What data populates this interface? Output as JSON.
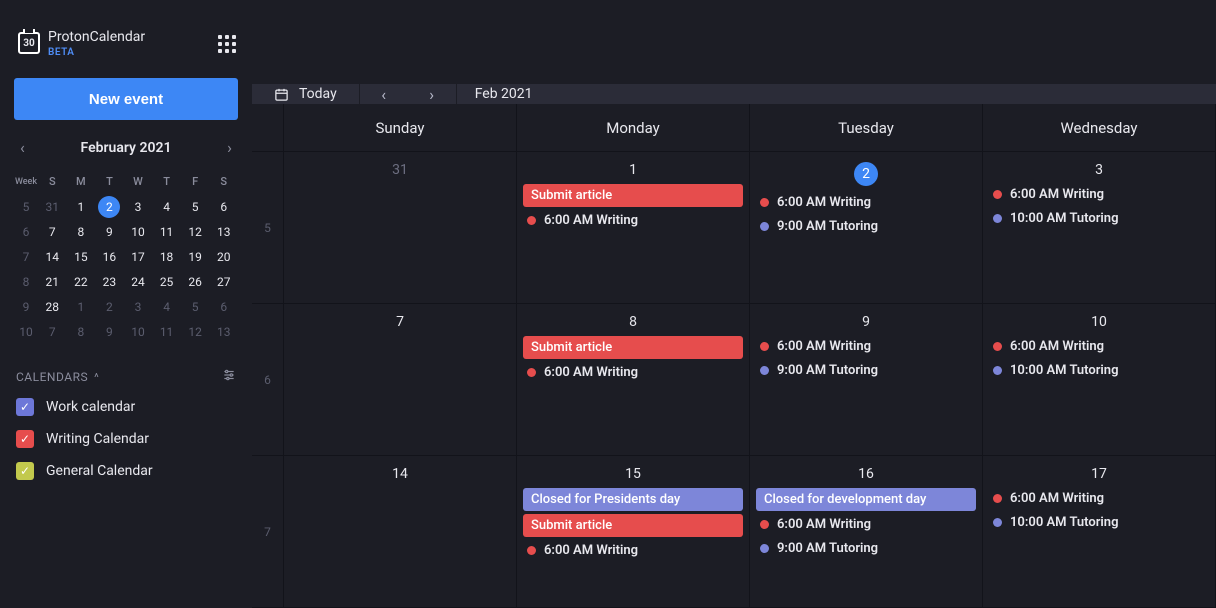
{
  "brand": {
    "name": "ProtonCalendar",
    "icon_label": "30",
    "beta": "BETA"
  },
  "sidebar": {
    "new_event": "New event",
    "mini_cal": {
      "title": "February 2021",
      "week_label": "Week",
      "weekday_heads": [
        "S",
        "M",
        "T",
        "W",
        "T",
        "F",
        "S"
      ],
      "rows": [
        {
          "wk": "5",
          "days": [
            {
              "n": "31",
              "out": true
            },
            {
              "n": "1"
            },
            {
              "n": "2",
              "today": true
            },
            {
              "n": "3"
            },
            {
              "n": "4"
            },
            {
              "n": "5"
            },
            {
              "n": "6"
            }
          ]
        },
        {
          "wk": "6",
          "days": [
            {
              "n": "7"
            },
            {
              "n": "8"
            },
            {
              "n": "9"
            },
            {
              "n": "10"
            },
            {
              "n": "11"
            },
            {
              "n": "12"
            },
            {
              "n": "13"
            }
          ]
        },
        {
          "wk": "7",
          "days": [
            {
              "n": "14"
            },
            {
              "n": "15"
            },
            {
              "n": "16"
            },
            {
              "n": "17"
            },
            {
              "n": "18"
            },
            {
              "n": "19"
            },
            {
              "n": "20"
            }
          ]
        },
        {
          "wk": "8",
          "days": [
            {
              "n": "21"
            },
            {
              "n": "22"
            },
            {
              "n": "23"
            },
            {
              "n": "24"
            },
            {
              "n": "25"
            },
            {
              "n": "26"
            },
            {
              "n": "27"
            }
          ]
        },
        {
          "wk": "9",
          "days": [
            {
              "n": "28"
            },
            {
              "n": "1",
              "out": true
            },
            {
              "n": "2",
              "out": true
            },
            {
              "n": "3",
              "out": true
            },
            {
              "n": "4",
              "out": true
            },
            {
              "n": "5",
              "out": true
            },
            {
              "n": "6",
              "out": true
            }
          ]
        },
        {
          "wk": "10",
          "days": [
            {
              "n": "7",
              "out": true
            },
            {
              "n": "8",
              "out": true
            },
            {
              "n": "9",
              "out": true
            },
            {
              "n": "10",
              "out": true
            },
            {
              "n": "11",
              "out": true
            },
            {
              "n": "12",
              "out": true
            },
            {
              "n": "13",
              "out": true
            }
          ]
        }
      ]
    },
    "calendars_heading": "CALENDARS",
    "calendars": [
      {
        "label": "Work calendar",
        "color": "#6d77d8"
      },
      {
        "label": "Writing Calendar",
        "color": "#e64d4d"
      },
      {
        "label": "General Calendar",
        "color": "#c2c94d"
      }
    ]
  },
  "toolbar": {
    "today": "Today",
    "period": "Feb 2021"
  },
  "month": {
    "weekday_heads": [
      "Sunday",
      "Monday",
      "Tuesday",
      "Wednesday"
    ],
    "weeks": [
      {
        "wk": "5",
        "days": [
          {
            "num": "31",
            "out": true,
            "events": []
          },
          {
            "num": "1",
            "events": [
              {
                "type": "block",
                "color": "#e64d4d",
                "label": "Submit article"
              },
              {
                "type": "dot",
                "color": "#e64d4d",
                "label": "6:00 AM Writing"
              }
            ]
          },
          {
            "num": "2",
            "today": true,
            "events": [
              {
                "type": "dot",
                "color": "#e64d4d",
                "label": "6:00 AM Writing"
              },
              {
                "type": "dot",
                "color": "#7d86d9",
                "label": "9:00 AM Tutoring"
              }
            ]
          },
          {
            "num": "3",
            "events": [
              {
                "type": "dot",
                "color": "#e64d4d",
                "label": "6:00 AM Writing"
              },
              {
                "type": "dot",
                "color": "#7d86d9",
                "label": "10:00 AM Tutoring"
              }
            ]
          }
        ]
      },
      {
        "wk": "6",
        "days": [
          {
            "num": "7",
            "events": []
          },
          {
            "num": "8",
            "events": [
              {
                "type": "block",
                "color": "#e64d4d",
                "label": "Submit article"
              },
              {
                "type": "dot",
                "color": "#e64d4d",
                "label": "6:00 AM Writing"
              }
            ]
          },
          {
            "num": "9",
            "events": [
              {
                "type": "dot",
                "color": "#e64d4d",
                "label": "6:00 AM Writing"
              },
              {
                "type": "dot",
                "color": "#7d86d9",
                "label": "9:00 AM Tutoring"
              }
            ]
          },
          {
            "num": "10",
            "events": [
              {
                "type": "dot",
                "color": "#e64d4d",
                "label": "6:00 AM Writing"
              },
              {
                "type": "dot",
                "color": "#7d86d9",
                "label": "10:00 AM Tutoring"
              }
            ]
          }
        ]
      },
      {
        "wk": "7",
        "days": [
          {
            "num": "14",
            "events": []
          },
          {
            "num": "15",
            "events": [
              {
                "type": "block",
                "color": "#7d86d9",
                "label": "Closed for Presidents day"
              },
              {
                "type": "block",
                "color": "#e64d4d",
                "label": "Submit article"
              },
              {
                "type": "dot",
                "color": "#e64d4d",
                "label": "6:00 AM Writing"
              }
            ]
          },
          {
            "num": "16",
            "events": [
              {
                "type": "block",
                "color": "#7d86d9",
                "label": "Closed for development day"
              },
              {
                "type": "dot",
                "color": "#e64d4d",
                "label": "6:00 AM Writing"
              },
              {
                "type": "dot",
                "color": "#7d86d9",
                "label": "9:00 AM Tutoring"
              }
            ]
          },
          {
            "num": "17",
            "events": [
              {
                "type": "dot",
                "color": "#e64d4d",
                "label": "6:00 AM Writing"
              },
              {
                "type": "dot",
                "color": "#7d86d9",
                "label": "10:00 AM Tutoring"
              }
            ]
          }
        ]
      }
    ]
  }
}
